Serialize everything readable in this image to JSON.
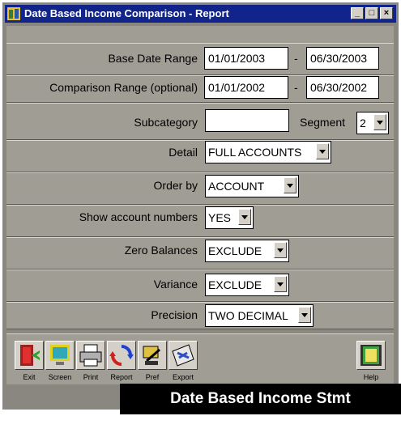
{
  "window": {
    "title": "Date Based Income Comparison - Report"
  },
  "form": {
    "base_label": "Base Date Range",
    "base_start": "01/01/2003",
    "base_sep": "-",
    "base_end": "06/30/2003",
    "comp_label": "Comparison Range (optional)",
    "comp_start": "01/01/2002",
    "comp_sep": "-",
    "comp_end": "06/30/2002",
    "subcategory_label": "Subcategory",
    "subcategory_value": "",
    "segment_label": "Segment",
    "segment_value": "2",
    "detail_label": "Detail",
    "detail_value": "FULL ACCOUNTS",
    "order_label": "Order by",
    "order_value": "ACCOUNT",
    "shownum_label": "Show account numbers",
    "shownum_value": "YES",
    "zero_label": "Zero Balances",
    "zero_value": "EXCLUDE",
    "variance_label": "Variance",
    "variance_value": "EXCLUDE",
    "precision_label": "Precision",
    "precision_value": "TWO DECIMAL"
  },
  "toolbar": {
    "exit": "Exit",
    "screen": "Screen",
    "print": "Print",
    "report": "Report",
    "pref": "Pref",
    "export": "Export",
    "help": "Help"
  },
  "banner": "Date Based Income Stmt"
}
